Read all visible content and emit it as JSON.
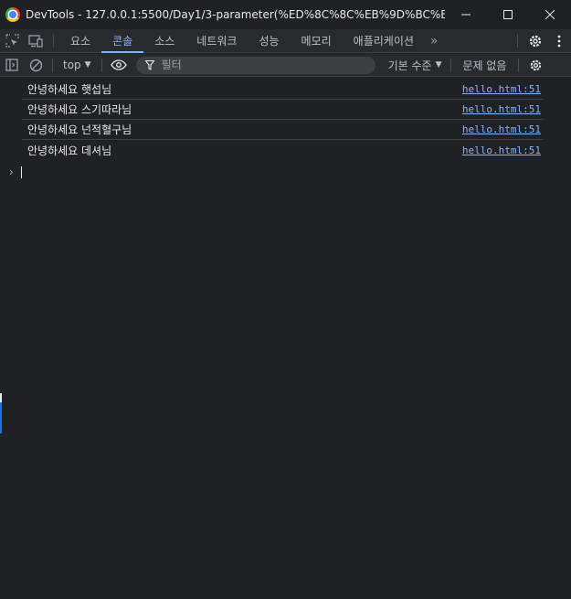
{
  "window": {
    "title": "DevTools - 127.0.0.1:5500/Day1/3-parameter(%ED%8C%8C%EB%9D%BC%EB%AF%...",
    "minimize_icon": "minimize-icon",
    "maximize_icon": "maximize-icon",
    "close_icon": "close-icon"
  },
  "tabs": [
    {
      "label": "요소",
      "active": false
    },
    {
      "label": "콘솔",
      "active": true
    },
    {
      "label": "소스",
      "active": false
    },
    {
      "label": "네트워크",
      "active": false
    },
    {
      "label": "성능",
      "active": false
    },
    {
      "label": "메모리",
      "active": false
    },
    {
      "label": "애플리케이션",
      "active": false
    }
  ],
  "console_toolbar": {
    "context": "top",
    "filter_placeholder": "필터",
    "levels": "기본 수준",
    "issues": "문제 없음"
  },
  "messages": [
    {
      "text": "안녕하세요 햇섭님",
      "source": "hello.html:51"
    },
    {
      "text": "안녕하세요 스기따라님",
      "source": "hello.html:51"
    },
    {
      "text": "안녕하세요 넌적혈구님",
      "source": "hello.html:51"
    },
    {
      "text": "안녕하세요 데셔님",
      "source": "hello.html:51"
    }
  ],
  "colors": {
    "background": "#202124",
    "accent": "#8ab4f8"
  }
}
